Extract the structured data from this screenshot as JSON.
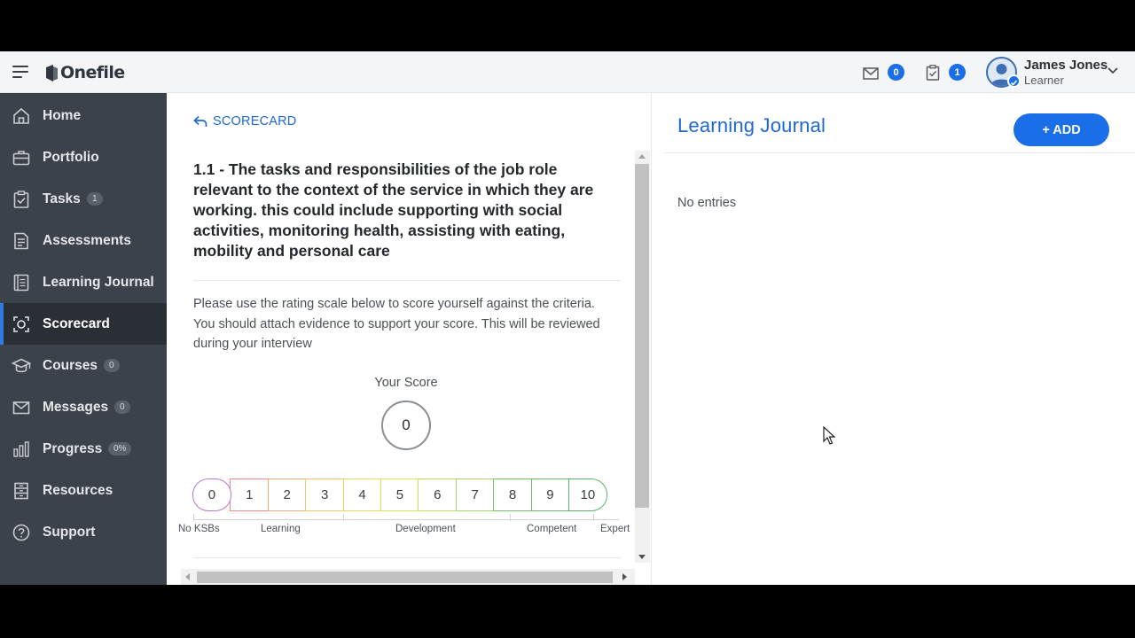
{
  "topbar": {
    "logo_text": "Onefile",
    "messages_count": "0",
    "tasks_count": "1",
    "user_name": "James Jones",
    "user_role": "Learner"
  },
  "sidebar": {
    "items": [
      {
        "label": "Home",
        "icon": "home-icon"
      },
      {
        "label": "Portfolio",
        "icon": "portfolio-icon"
      },
      {
        "label": "Tasks",
        "icon": "tasks-icon",
        "badge": "1"
      },
      {
        "label": "Assessments",
        "icon": "assessments-icon"
      },
      {
        "label": "Learning Journal",
        "icon": "learning-journal-icon"
      },
      {
        "label": "Scorecard",
        "icon": "scorecard-icon",
        "active": true
      },
      {
        "label": "Courses",
        "icon": "courses-icon",
        "badge": "0"
      },
      {
        "label": "Messages",
        "icon": "messages-icon",
        "badge": "0"
      },
      {
        "label": "Progress",
        "icon": "progress-icon",
        "badge": "0%"
      },
      {
        "label": "Resources",
        "icon": "resources-icon"
      },
      {
        "label": "Support",
        "icon": "support-icon"
      }
    ]
  },
  "criterion": {
    "back_label": "SCORECARD",
    "title": "1.1 - The tasks and responsibilities of the job role relevant to the context of the service in which they are working. this could include supporting with social activities, monitoring health, assisting with eating, mobility and personal care",
    "instructions": "Please use the rating scale below to score yourself against the criteria. You should attach evidence to support your score. This will be reviewed during your interview",
    "your_score_label": "Your Score",
    "score_value": "0",
    "scale": [
      "0",
      "1",
      "2",
      "3",
      "4",
      "5",
      "6",
      "7",
      "8",
      "9",
      "10"
    ],
    "scale_colors": [
      "#b478d6",
      "#f08a8a",
      "#f2a774",
      "#f4c66e",
      "#ecd85a",
      "#dce25a",
      "#c5de63",
      "#a8d86a",
      "#74c46c",
      "#66bd6c",
      "#5ab56a"
    ],
    "scale_labels": [
      "No KSBs",
      "Learning",
      "Development",
      "Competent",
      "Expert"
    ]
  },
  "journal": {
    "title": "Learning Journal",
    "add_label": "+ ADD",
    "empty_text": "No entries"
  },
  "colors": {
    "accent": "#1a6ee8",
    "link": "#1f68d3",
    "sidebar_bg": "#3c424a"
  }
}
